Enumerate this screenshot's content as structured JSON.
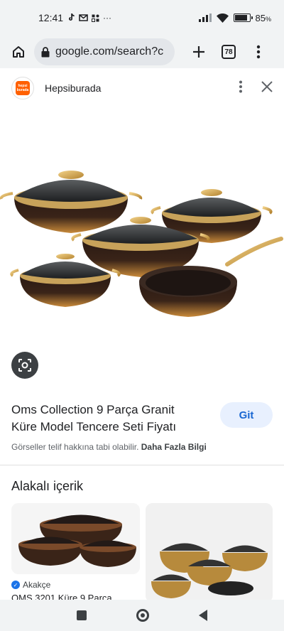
{
  "status_bar": {
    "time": "12:41",
    "battery": "85",
    "battery_unit": "%",
    "battery_level": 0.85
  },
  "browser": {
    "url": "google.com/search?c",
    "tab_count": "78"
  },
  "source": {
    "name": "Hepsiburada",
    "logo_text": "hepsi burada"
  },
  "product": {
    "title": "Oms Collection 9 Parça Granit Küre Model Tencere Seti Fiyatı",
    "visit_label": "Git",
    "copyright_text": "Görseller telif hakkına tabi olabilir.",
    "more_info_label": "Daha Fazla Bilgi"
  },
  "related": {
    "heading": "Alakalı içerik",
    "cards": [
      {
        "source": "Akakçe",
        "caption": "OMS 3201 Küre 9 Parça"
      },
      {
        "source": "",
        "caption": ""
      }
    ]
  },
  "icons": {
    "home": "home-icon",
    "lock": "lock-icon",
    "new_tab": "plus-icon",
    "menu": "more-vert-icon",
    "close": "close-icon",
    "lens": "lens-icon"
  }
}
